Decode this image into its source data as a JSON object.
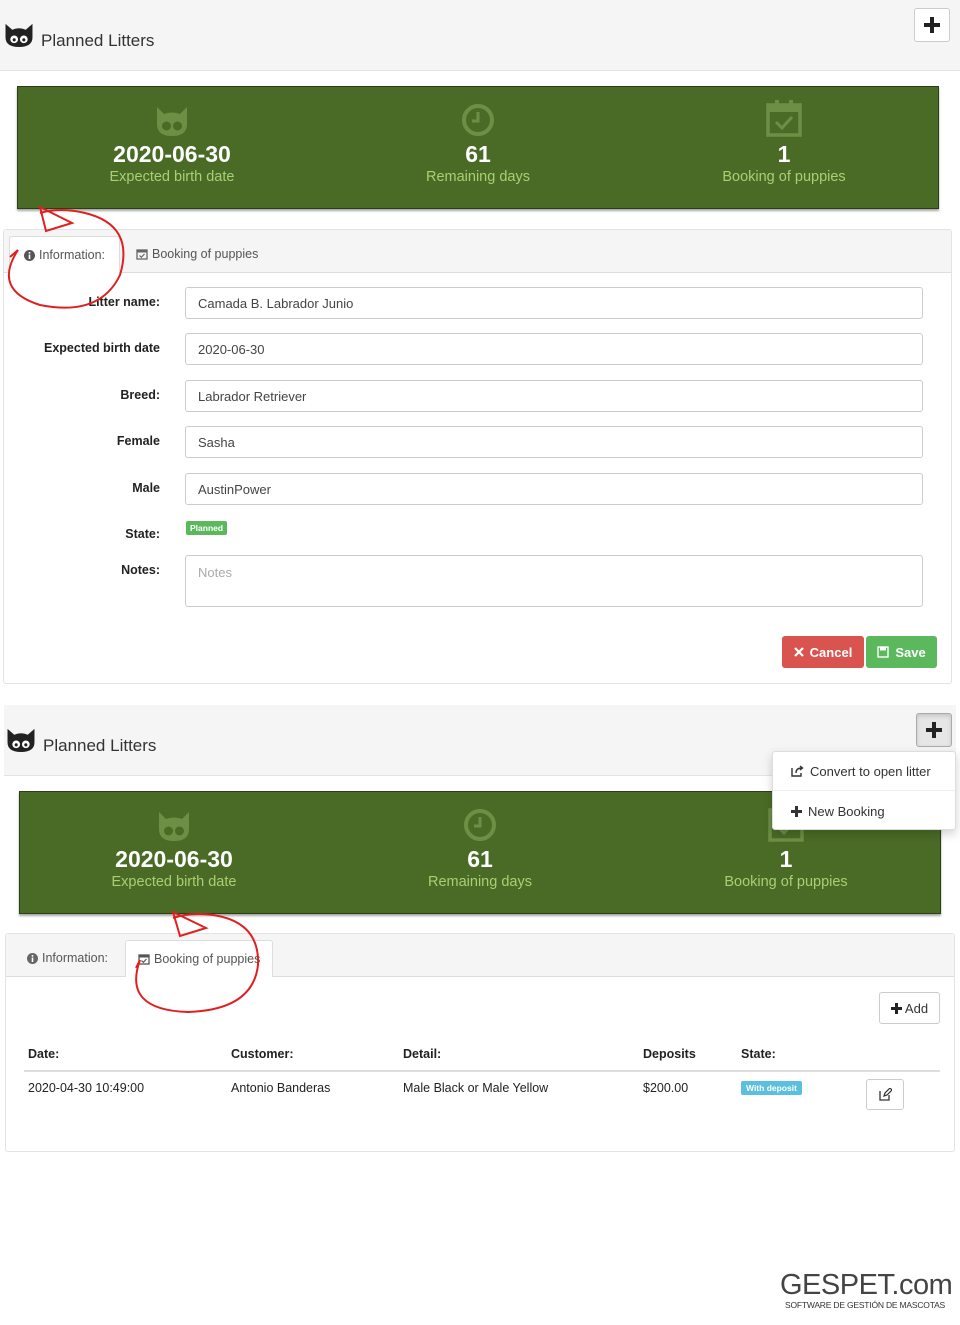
{
  "section1": {
    "header": {
      "title": "Planned Litters",
      "add_button": "+"
    },
    "stats": [
      {
        "value": "2020-06-30",
        "label": "Expected birth date",
        "icon": "cat-icon"
      },
      {
        "value": "61",
        "label": "Remaining days",
        "icon": "clock-icon"
      },
      {
        "value": "1",
        "label": "Booking of puppies",
        "icon": "calendar-check-icon"
      }
    ],
    "tabs": {
      "info": "Information:",
      "booking": "Booking of puppies"
    },
    "form": {
      "litter_name_label": "Litter name:",
      "litter_name_value": "Camada B. Labrador Junio",
      "birth_label": "Expected birth date",
      "birth_value": "2020-06-30",
      "breed_label": "Breed:",
      "breed_value": "Labrador Retriever",
      "female_label": "Female",
      "female_value": "Sasha",
      "male_label": "Male",
      "male_value": "AustinPower",
      "state_label": "State:",
      "state_badge": "Planned",
      "notes_label": "Notes:",
      "notes_placeholder": "Notes"
    },
    "buttons": {
      "cancel": "Cancel",
      "save": "Save"
    }
  },
  "section2": {
    "header": {
      "title": "Planned Litters",
      "add_button": "+"
    },
    "dropdown": {
      "convert": "Convert to open litter",
      "new_booking": "New Booking"
    },
    "stats": [
      {
        "value": "2020-06-30",
        "label": "Expected birth date",
        "icon": "cat-icon"
      },
      {
        "value": "61",
        "label": "Remaining days",
        "icon": "clock-icon"
      },
      {
        "value": "1",
        "label": "Booking of puppies",
        "icon": "calendar-check-icon"
      }
    ],
    "tabs": {
      "info": "Information:",
      "booking": "Booking of puppies"
    },
    "add_button": "Add",
    "table": {
      "headers": [
        "Date:",
        "Customer:",
        "Detail:",
        "Deposits",
        "State:"
      ],
      "rows": [
        {
          "date": "2020-04-30 10:49:00",
          "customer": "Antonio Banderas",
          "detail": "Male Black or Male Yellow",
          "deposit": "$200.00",
          "state": "With deposit"
        }
      ]
    }
  },
  "brand": {
    "name": "GESPET.com",
    "tagline": "SOFTWARE DE GESTIÓN DE MASCOTAS"
  },
  "colors": {
    "banner": "#4a6b26",
    "banner_label": "#a8cf74",
    "cancel": "#d9534f",
    "save": "#5cb85c",
    "info_badge": "#5bc0de",
    "annotation": "#e02020"
  }
}
